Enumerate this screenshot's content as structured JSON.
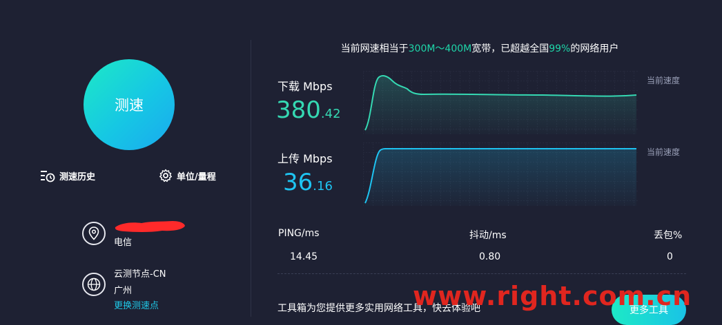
{
  "test_button": {
    "label": "测速"
  },
  "options": {
    "history_label": "测速历史",
    "units_label": "单位/量程"
  },
  "isp": {
    "name": "电信"
  },
  "node": {
    "name": "云测节点-CN",
    "city": "广州",
    "change_link": "更换测速点"
  },
  "headline": {
    "prefix": "当前网速相当于",
    "range": "300M～400M",
    "middle": "宽带，已超越全国",
    "percent": "99%",
    "suffix": "的网络用户"
  },
  "download": {
    "label": "下载 Mbps",
    "value_int": "380",
    "value_dec": ".42",
    "current_label": "当前速度"
  },
  "upload": {
    "label": "上传 Mbps",
    "value_int": "36",
    "value_dec": ".16",
    "current_label": "当前速度"
  },
  "stats": {
    "ping_label": "PING/ms",
    "ping_value": "14.45",
    "jitter_label": "抖动/ms",
    "jitter_value": "0.80",
    "loss_label": "丢包%",
    "loss_value": "0"
  },
  "footer": {
    "text": "工具箱为您提供更多实用网络工具，快去体验吧",
    "more_button": "更多工具"
  },
  "watermark": "www.right.com.cn",
  "colors": {
    "background": "#1e2133",
    "download": "#35d9b3",
    "upload": "#1ec4f2",
    "accent_start": "#1de9c6",
    "accent_end": "#1aa9ef"
  }
}
